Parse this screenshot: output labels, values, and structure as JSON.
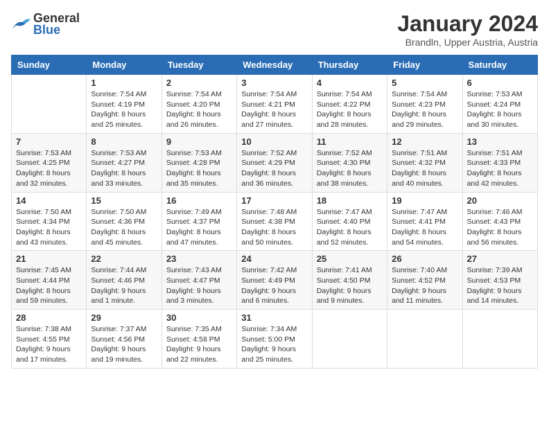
{
  "header": {
    "logo_general": "General",
    "logo_blue": "Blue",
    "month_title": "January 2024",
    "location": "Brandln, Upper Austria, Austria"
  },
  "weekdays": [
    "Sunday",
    "Monday",
    "Tuesday",
    "Wednesday",
    "Thursday",
    "Friday",
    "Saturday"
  ],
  "weeks": [
    [
      {
        "day": "",
        "info": ""
      },
      {
        "day": "1",
        "info": "Sunrise: 7:54 AM\nSunset: 4:19 PM\nDaylight: 8 hours\nand 25 minutes."
      },
      {
        "day": "2",
        "info": "Sunrise: 7:54 AM\nSunset: 4:20 PM\nDaylight: 8 hours\nand 26 minutes."
      },
      {
        "day": "3",
        "info": "Sunrise: 7:54 AM\nSunset: 4:21 PM\nDaylight: 8 hours\nand 27 minutes."
      },
      {
        "day": "4",
        "info": "Sunrise: 7:54 AM\nSunset: 4:22 PM\nDaylight: 8 hours\nand 28 minutes."
      },
      {
        "day": "5",
        "info": "Sunrise: 7:54 AM\nSunset: 4:23 PM\nDaylight: 8 hours\nand 29 minutes."
      },
      {
        "day": "6",
        "info": "Sunrise: 7:53 AM\nSunset: 4:24 PM\nDaylight: 8 hours\nand 30 minutes."
      }
    ],
    [
      {
        "day": "7",
        "info": "Sunrise: 7:53 AM\nSunset: 4:25 PM\nDaylight: 8 hours\nand 32 minutes."
      },
      {
        "day": "8",
        "info": "Sunrise: 7:53 AM\nSunset: 4:27 PM\nDaylight: 8 hours\nand 33 minutes."
      },
      {
        "day": "9",
        "info": "Sunrise: 7:53 AM\nSunset: 4:28 PM\nDaylight: 8 hours\nand 35 minutes."
      },
      {
        "day": "10",
        "info": "Sunrise: 7:52 AM\nSunset: 4:29 PM\nDaylight: 8 hours\nand 36 minutes."
      },
      {
        "day": "11",
        "info": "Sunrise: 7:52 AM\nSunset: 4:30 PM\nDaylight: 8 hours\nand 38 minutes."
      },
      {
        "day": "12",
        "info": "Sunrise: 7:51 AM\nSunset: 4:32 PM\nDaylight: 8 hours\nand 40 minutes."
      },
      {
        "day": "13",
        "info": "Sunrise: 7:51 AM\nSunset: 4:33 PM\nDaylight: 8 hours\nand 42 minutes."
      }
    ],
    [
      {
        "day": "14",
        "info": "Sunrise: 7:50 AM\nSunset: 4:34 PM\nDaylight: 8 hours\nand 43 minutes."
      },
      {
        "day": "15",
        "info": "Sunrise: 7:50 AM\nSunset: 4:36 PM\nDaylight: 8 hours\nand 45 minutes."
      },
      {
        "day": "16",
        "info": "Sunrise: 7:49 AM\nSunset: 4:37 PM\nDaylight: 8 hours\nand 47 minutes."
      },
      {
        "day": "17",
        "info": "Sunrise: 7:48 AM\nSunset: 4:38 PM\nDaylight: 8 hours\nand 50 minutes."
      },
      {
        "day": "18",
        "info": "Sunrise: 7:47 AM\nSunset: 4:40 PM\nDaylight: 8 hours\nand 52 minutes."
      },
      {
        "day": "19",
        "info": "Sunrise: 7:47 AM\nSunset: 4:41 PM\nDaylight: 8 hours\nand 54 minutes."
      },
      {
        "day": "20",
        "info": "Sunrise: 7:46 AM\nSunset: 4:43 PM\nDaylight: 8 hours\nand 56 minutes."
      }
    ],
    [
      {
        "day": "21",
        "info": "Sunrise: 7:45 AM\nSunset: 4:44 PM\nDaylight: 8 hours\nand 59 minutes."
      },
      {
        "day": "22",
        "info": "Sunrise: 7:44 AM\nSunset: 4:46 PM\nDaylight: 9 hours\nand 1 minute."
      },
      {
        "day": "23",
        "info": "Sunrise: 7:43 AM\nSunset: 4:47 PM\nDaylight: 9 hours\nand 3 minutes."
      },
      {
        "day": "24",
        "info": "Sunrise: 7:42 AM\nSunset: 4:49 PM\nDaylight: 9 hours\nand 6 minutes."
      },
      {
        "day": "25",
        "info": "Sunrise: 7:41 AM\nSunset: 4:50 PM\nDaylight: 9 hours\nand 9 minutes."
      },
      {
        "day": "26",
        "info": "Sunrise: 7:40 AM\nSunset: 4:52 PM\nDaylight: 9 hours\nand 11 minutes."
      },
      {
        "day": "27",
        "info": "Sunrise: 7:39 AM\nSunset: 4:53 PM\nDaylight: 9 hours\nand 14 minutes."
      }
    ],
    [
      {
        "day": "28",
        "info": "Sunrise: 7:38 AM\nSunset: 4:55 PM\nDaylight: 9 hours\nand 17 minutes."
      },
      {
        "day": "29",
        "info": "Sunrise: 7:37 AM\nSunset: 4:56 PM\nDaylight: 9 hours\nand 19 minutes."
      },
      {
        "day": "30",
        "info": "Sunrise: 7:35 AM\nSunset: 4:58 PM\nDaylight: 9 hours\nand 22 minutes."
      },
      {
        "day": "31",
        "info": "Sunrise: 7:34 AM\nSunset: 5:00 PM\nDaylight: 9 hours\nand 25 minutes."
      },
      {
        "day": "",
        "info": ""
      },
      {
        "day": "",
        "info": ""
      },
      {
        "day": "",
        "info": ""
      }
    ]
  ]
}
